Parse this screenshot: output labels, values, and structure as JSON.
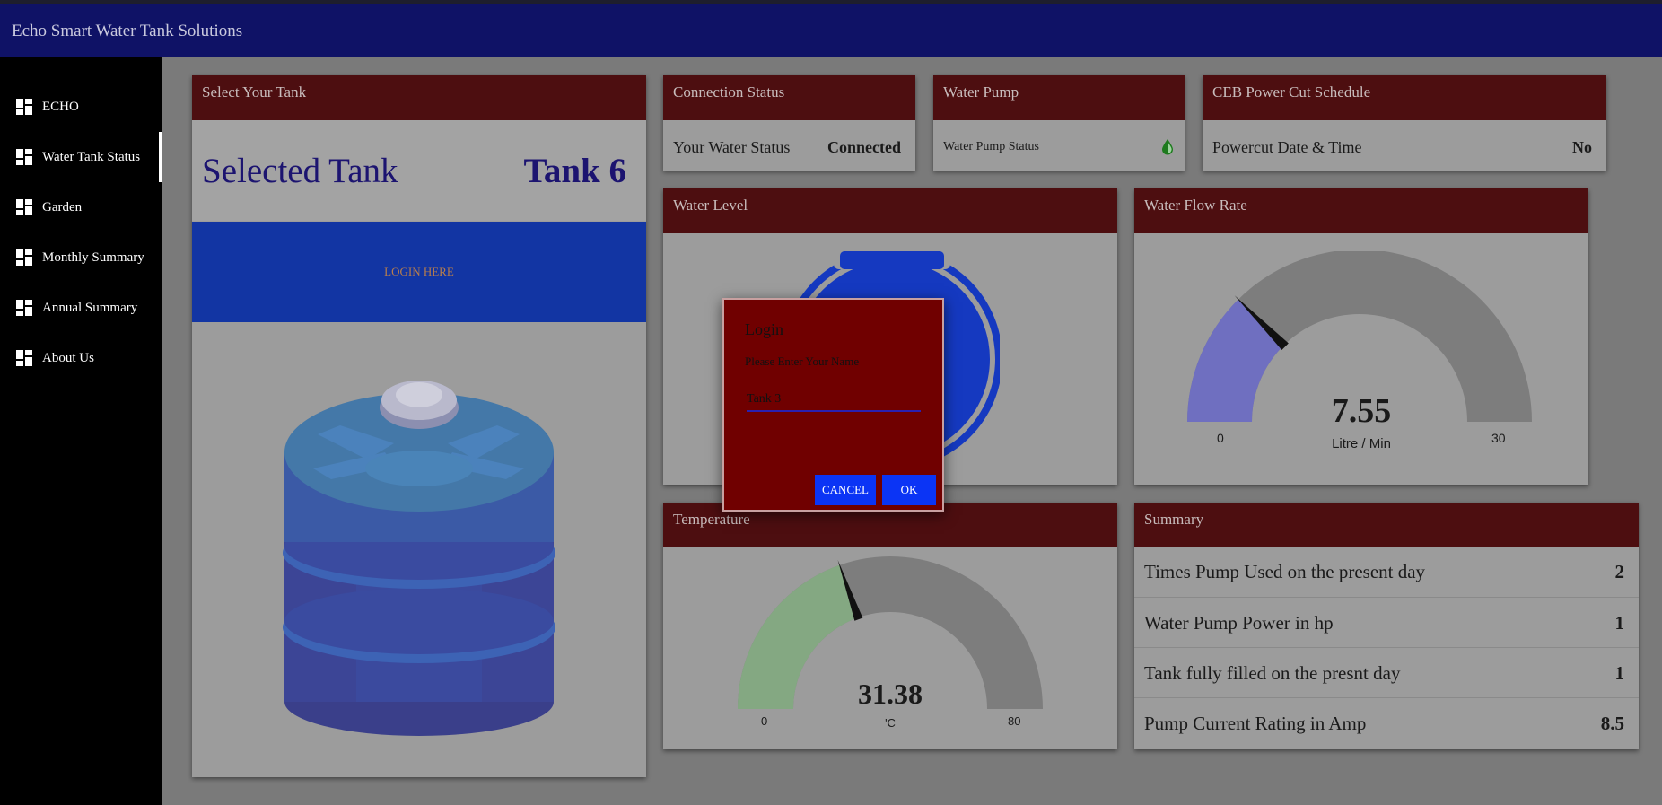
{
  "app": {
    "title": "Echo Smart Water Tank Solutions"
  },
  "sidebar": {
    "items": [
      {
        "label": "ECHO",
        "icon": "dashboard-icon"
      },
      {
        "label": "Water Tank Status",
        "icon": "dashboard-icon"
      },
      {
        "label": "Garden",
        "icon": "dashboard-icon"
      },
      {
        "label": "Monthly Summary",
        "icon": "dashboard-icon"
      },
      {
        "label": "Annual Summary",
        "icon": "dashboard-icon"
      },
      {
        "label": "About Us",
        "icon": "dashboard-icon"
      }
    ],
    "active_index": 1
  },
  "tank_card": {
    "title": "Select Your Tank",
    "selected_label": "Selected Tank",
    "selected_value": "Tank 6",
    "login_button": "LOGIN HERE",
    "image_icon": "water-tank-icon"
  },
  "connection": {
    "title": "Connection Status",
    "label": "Your Water Status",
    "value": "Connected"
  },
  "pump": {
    "title": "Water Pump",
    "label": "Water Pump Status",
    "icon": "water-drop-icon",
    "icon_color": "#1e7a1e"
  },
  "power_cut": {
    "title": "CEB Power Cut Schedule",
    "label": "Powercut Date & Time",
    "value": "No"
  },
  "water_level": {
    "title": "Water Level"
  },
  "flow_rate": {
    "title": "Water Flow Rate",
    "value": "7.55",
    "unit": "Litre / Min",
    "min": "0",
    "max": "30",
    "fill_color": "#6f6fc0",
    "level": 7.55
  },
  "temperature": {
    "title": "Temperature",
    "value": "31.38",
    "unit": "'C",
    "min": "0",
    "max": "80",
    "fill_color": "#84a882",
    "level": 31.38
  },
  "summary": {
    "title": "Summary",
    "rows": [
      {
        "label": "Times Pump Used on the present day",
        "value": "2"
      },
      {
        "label": "Water Pump Power in hp",
        "value": "1"
      },
      {
        "label": "Tank fully filled on the presnt day",
        "value": "1"
      },
      {
        "label": "Pump Current Rating in Amp",
        "value": "8.5"
      }
    ]
  },
  "dialog": {
    "title": "Login",
    "prompt": "Please Enter Your Name",
    "input_value": "Tank 3",
    "cancel_label": "CANCEL",
    "ok_label": "OK"
  },
  "colors": {
    "header": "#0f1266",
    "card_head": "#4d0e10",
    "dialog_bg": "#700000",
    "button": "#0b34f5",
    "login_band": "#1235a3"
  }
}
